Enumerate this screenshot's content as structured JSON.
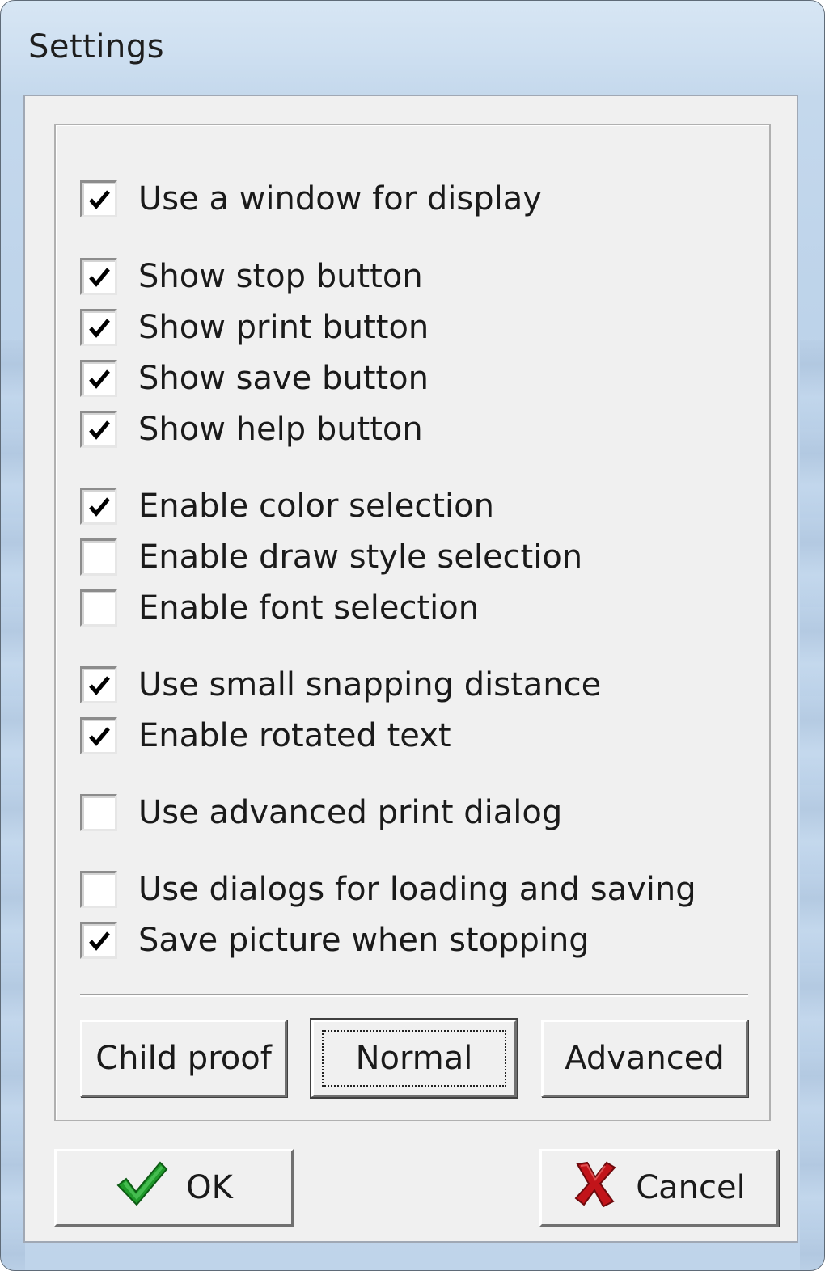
{
  "window": {
    "title": "Settings"
  },
  "options": [
    {
      "label": "Use a window for display",
      "checked": true
    },
    {
      "label": "Show stop button",
      "checked": true
    },
    {
      "label": "Show print button",
      "checked": true
    },
    {
      "label": "Show save button",
      "checked": true
    },
    {
      "label": "Show help button",
      "checked": true
    },
    {
      "label": "Enable color selection",
      "checked": true
    },
    {
      "label": "Enable draw style selection",
      "checked": false
    },
    {
      "label": "Enable font selection",
      "checked": false
    },
    {
      "label": "Use small snapping distance",
      "checked": true
    },
    {
      "label": "Enable rotated text",
      "checked": true
    },
    {
      "label": "Use advanced print dialog",
      "checked": false
    },
    {
      "label": "Use dialogs for loading and saving",
      "checked": false
    },
    {
      "label": "Save picture when stopping",
      "checked": true
    }
  ],
  "presets": {
    "child_proof": "Child proof",
    "normal": "Normal",
    "advanced": "Advanced"
  },
  "actions": {
    "ok": "OK",
    "cancel": "Cancel"
  },
  "icons": {
    "ok": "green-checkmark-icon",
    "cancel": "red-x-icon"
  },
  "colors": {
    "ok_icon": "#1f9a2a",
    "cancel_icon": "#c2141a",
    "title_bar": "#cfe0f1",
    "dialog_face": "#f0f0f0"
  }
}
